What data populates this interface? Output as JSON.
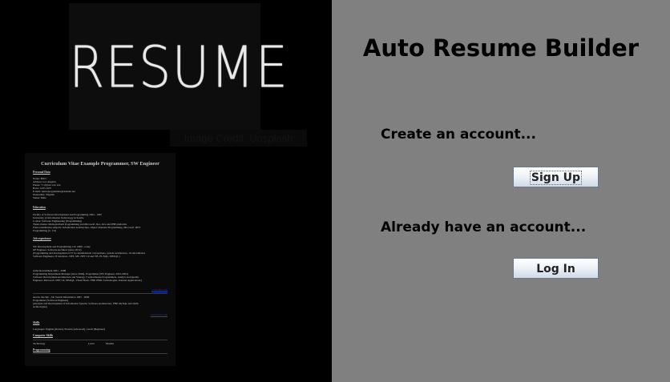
{
  "app": {
    "title": "Auto Resume Builder"
  },
  "chalk_image": {
    "text": "RESUME"
  },
  "image_caption": {
    "text": "Image Credit: Unsplash"
  },
  "cv_image": {
    "title": "Curriculum Vitae Example Programmer, SW Engineer",
    "lines": [
      "Personal Data",
      "Name: Bill C",
      "Address: Los Angeles",
      "Phone: +1 (0)xxx xxx xxx",
      "Born: 12.05.1975",
      "E-mail: seniorprogrammer@domain.net",
      "Nationality: English",
      "Status: Male",
      "Education",
      "Faculty of Software Development and Programming 1992 - 1997",
      "University of Information Technology in Seattle",
      "Course: Software Engineering (Programming)",
      "Thesis theme: Multi-platform Programming and Microsoft .Net, Java and PHP platforms",
      "Final examination subjects: Information Architecture, Object Oriented Programming, Microsoft .NET",
      "Programming (C, C#)",
      "Job experience",
      "SW Development and Programming Ltd. 2009 - today",
      "OF Engineer, Software Architect (since 2012)",
      "(Programming and development of IT for multinational corporations, system architecture, 10 subordinates",
      "Software Engineers, IT Analysts, .NET, MS .NET C# and VB, PL/SQL, MSSQL.)",
      "Adlet Recruitment 2001 - 2008",
      "Programming Department Manager (since 2004), Programmer (SW Engineer, 2001-2004)",
      "Software Development Architecture and Strategy, 5 subordinates Programmers, Analyst and Quality",
      "Engineer; Microsoft .NET C#, MSSQL, Visual Basic, PHP, PERL Technologies, Internet Applications)",
      "Arevis Jobclub - Job Search Information 1997 - 2000",
      "Programmer (Software Engineer)",
      "(Analysis and Development of Information System, Software Architecture, PHP, MySQL and JAVA",
      "technologies)",
      "Skills",
      "Languages: English (Native), French (Advanced), Czech (Beginner)",
      "Computer Skills",
      "Technology",
      "Level",
      "Months",
      "Programming"
    ],
    "links": [
      "www.adlet.com",
      "www.arevis.com"
    ]
  },
  "signup": {
    "prompt": "Create an account...",
    "button_label": "Sign Up"
  },
  "login": {
    "prompt": "Already have an account...",
    "button_label": "Log In"
  }
}
